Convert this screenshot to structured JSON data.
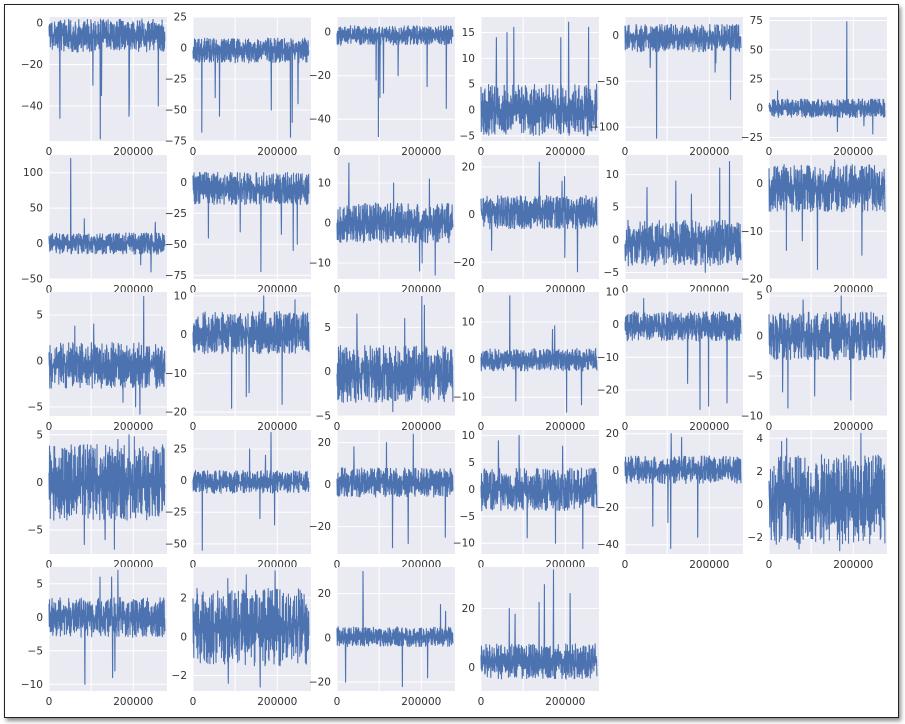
{
  "theme": {
    "panel_bg": "#eaeaf2",
    "grid_color": "#ffffff",
    "line_color": "#4c72b0",
    "tick_color": "#333333"
  },
  "chart_data": [
    {
      "type": "line",
      "xlim": [
        0,
        280000
      ],
      "ylim": [
        -57,
        3
      ],
      "yticks": [
        0,
        -20,
        -40
      ],
      "xticks": [
        0,
        200000
      ],
      "ytick_side": "left",
      "baseline": 2,
      "typical_range": [
        -14,
        2
      ],
      "spikes": [
        -56,
        -46,
        -40,
        -45,
        -35,
        -38,
        -30
      ]
    },
    {
      "type": "line",
      "xlim": [
        0,
        280000
      ],
      "ylim": [
        -75,
        25
      ],
      "yticks": [
        25,
        0,
        -25,
        -50,
        -75
      ],
      "xticks": [
        0,
        200000
      ],
      "ytick_side": "left",
      "baseline": 0,
      "typical_range": [
        -12,
        8
      ],
      "spikes": [
        -72,
        -68,
        -60,
        -55,
        -50,
        -45,
        -40
      ]
    },
    {
      "type": "line",
      "xlim": [
        0,
        280000
      ],
      "ylim": [
        -50,
        7
      ],
      "yticks": [
        0,
        -20,
        -40
      ],
      "xticks": [
        0,
        200000
      ],
      "ytick_side": "left",
      "baseline": 0,
      "typical_range": [
        -6,
        3
      ],
      "spikes": [
        -48,
        -35,
        -30,
        -28,
        -25,
        -22,
        -20
      ]
    },
    {
      "type": "line",
      "xlim": [
        0,
        280000
      ],
      "ylim": [
        -6,
        18
      ],
      "yticks": [
        15,
        10,
        5,
        0,
        -5
      ],
      "xticks": [
        0,
        200000
      ],
      "ytick_side": "left",
      "baseline": 0,
      "typical_range": [
        -5,
        5
      ],
      "spikes": [
        17,
        16,
        16,
        15,
        14,
        14
      ]
    },
    {
      "type": "line",
      "xlim": [
        0,
        280000
      ],
      "ylim": [
        -115,
        20
      ],
      "yticks": [
        0,
        -50,
        -100
      ],
      "xticks": [
        0,
        200000
      ],
      "ytick_side": "left",
      "baseline": 0,
      "typical_range": [
        -18,
        12
      ],
      "spikes": [
        -112,
        -70,
        -40,
        -35,
        -30
      ]
    },
    {
      "type": "line",
      "xlim": [
        0,
        280000
      ],
      "ylim": [
        -28,
        78
      ],
      "yticks": [
        75,
        50,
        25,
        0,
        -25
      ],
      "xticks": [
        0,
        200000
      ],
      "ytick_side": "left",
      "baseline": 0,
      "typical_range": [
        -8,
        8
      ],
      "spikes": [
        74,
        -22,
        -20,
        -18,
        -15,
        15
      ]
    },
    {
      "type": "line",
      "xlim": [
        0,
        280000
      ],
      "ylim": [
        -50,
        125
      ],
      "yticks": [
        100,
        50,
        0,
        -50
      ],
      "xticks": [
        0,
        200000
      ],
      "ytick_side": "left",
      "baseline": 0,
      "typical_range": [
        -15,
        15
      ],
      "spikes": [
        120,
        -40,
        35,
        30,
        -30
      ]
    },
    {
      "type": "line",
      "xlim": [
        0,
        280000
      ],
      "ylim": [
        -78,
        22
      ],
      "yticks": [
        0,
        -25,
        -50,
        -75
      ],
      "xticks": [
        0,
        200000
      ],
      "ytick_side": "left",
      "baseline": 0,
      "typical_range": [
        -18,
        8
      ],
      "spikes": [
        -72,
        -55,
        -50,
        -45,
        -42,
        -40
      ]
    },
    {
      "type": "line",
      "xlim": [
        0,
        280000
      ],
      "ylim": [
        -14,
        17
      ],
      "yticks": [
        10,
        0,
        -10
      ],
      "xticks": [
        0,
        200000
      ],
      "ytick_side": "left",
      "baseline": 0,
      "typical_range": [
        -5,
        5
      ],
      "spikes": [
        15,
        -13,
        -12,
        -10,
        11,
        10
      ]
    },
    {
      "type": "line",
      "xlim": [
        0,
        280000
      ],
      "ylim": [
        -27,
        25
      ],
      "yticks": [
        20,
        0,
        -20
      ],
      "xticks": [
        0,
        200000
      ],
      "ytick_side": "left",
      "baseline": 0,
      "typical_range": [
        -6,
        8
      ],
      "spikes": [
        22,
        -24,
        -18,
        -15,
        16,
        14
      ]
    },
    {
      "type": "line",
      "xlim": [
        0,
        280000
      ],
      "ylim": [
        -6,
        13
      ],
      "yticks": [
        10,
        5,
        0,
        -5
      ],
      "xticks": [
        0,
        200000
      ],
      "ytick_side": "left",
      "baseline": 0,
      "typical_range": [
        -4,
        3
      ],
      "spikes": [
        12,
        11,
        9,
        8,
        -5,
        7
      ]
    },
    {
      "type": "line",
      "xlim": [
        0,
        280000
      ],
      "ylim": [
        -20,
        6
      ],
      "yticks": [
        0,
        -10,
        -20
      ],
      "xticks": [
        0,
        200000
      ],
      "ytick_side": "left",
      "baseline": 0,
      "typical_range": [
        -6,
        4
      ],
      "spikes": [
        -18,
        -15,
        -14,
        -12,
        5
      ]
    },
    {
      "type": "line",
      "xlim": [
        0,
        280000
      ],
      "ylim": [
        -6,
        7.5
      ],
      "yticks": [
        5,
        0,
        -5
      ],
      "xticks": [
        0,
        200000
      ],
      "ytick_side": "left",
      "baseline": 0,
      "typical_range": [
        -3,
        2
      ],
      "spikes": [
        7,
        -5.8,
        -5,
        4,
        -4.5,
        3.8
      ]
    },
    {
      "type": "line",
      "xlim": [
        0,
        280000
      ],
      "ylim": [
        -21,
        11
      ],
      "yticks": [
        10,
        0,
        -10,
        -20
      ],
      "xticks": [
        0,
        200000
      ],
      "ytick_side": "left",
      "baseline": 0,
      "typical_range": [
        -5,
        6
      ],
      "spikes": [
        -19,
        -18,
        -16,
        -15,
        10,
        9
      ]
    },
    {
      "type": "line",
      "xlim": [
        0,
        280000
      ],
      "ylim": [
        -5,
        9
      ],
      "yticks": [
        5,
        0,
        -5
      ],
      "xticks": [
        0,
        200000
      ],
      "ytick_side": "left",
      "baseline": 0,
      "typical_range": [
        -3.5,
        3
      ],
      "spikes": [
        8.5,
        7.5,
        6.5,
        6,
        -4.5
      ]
    },
    {
      "type": "line",
      "xlim": [
        0,
        280000
      ],
      "ylim": [
        -15,
        18
      ],
      "yticks": [
        10,
        0,
        -10
      ],
      "xticks": [
        0,
        200000
      ],
      "ytick_side": "left",
      "baseline": 0,
      "typical_range": [
        -3,
        3
      ],
      "spikes": [
        17,
        -14,
        -12,
        -11,
        8,
        9
      ]
    },
    {
      "type": "line",
      "xlim": [
        0,
        280000
      ],
      "ylim": [
        -28,
        10
      ],
      "yticks": [
        10,
        0,
        -10,
        -20
      ],
      "xticks": [
        0,
        200000
      ],
      "ytick_side": "left",
      "baseline": 0,
      "typical_range": [
        -5,
        4
      ],
      "spikes": [
        -26,
        -25,
        -24,
        -20,
        -18,
        8
      ]
    },
    {
      "type": "line",
      "xlim": [
        0,
        280000
      ],
      "ylim": [
        -10,
        5.5
      ],
      "yticks": [
        5,
        0,
        -5,
        -10
      ],
      "xticks": [
        0,
        200000
      ],
      "ytick_side": "left",
      "baseline": 0,
      "typical_range": [
        -3,
        3
      ],
      "spikes": [
        -9,
        -8,
        -7.5,
        -7,
        5,
        4.5
      ]
    },
    {
      "type": "line",
      "xlim": [
        0,
        280000
      ],
      "ylim": [
        -7.5,
        5.5
      ],
      "yticks": [
        5,
        0,
        -5
      ],
      "xticks": [
        0,
        200000
      ],
      "ytick_side": "left",
      "baseline": 0,
      "typical_range": [
        -4,
        4
      ],
      "spikes": [
        -7,
        5,
        -6.5,
        4.8,
        -6,
        4.5
      ]
    },
    {
      "type": "line",
      "xlim": [
        0,
        280000
      ],
      "ylim": [
        -58,
        40
      ],
      "yticks": [
        25,
        0,
        -25,
        -50
      ],
      "xticks": [
        0,
        200000
      ],
      "ytick_side": "left",
      "baseline": 0,
      "typical_range": [
        -10,
        8
      ],
      "spikes": [
        -55,
        38,
        -35,
        -30,
        25,
        20
      ]
    },
    {
      "type": "line",
      "xlim": [
        0,
        280000
      ],
      "ylim": [
        -33,
        26
      ],
      "yticks": [
        20,
        0,
        -20
      ],
      "xticks": [
        0,
        200000
      ],
      "ytick_side": "left",
      "baseline": 0,
      "typical_range": [
        -6,
        8
      ],
      "spikes": [
        -30,
        24,
        -28,
        -25,
        20,
        18
      ]
    },
    {
      "type": "line",
      "xlim": [
        0,
        280000
      ],
      "ylim": [
        -12,
        11
      ],
      "yticks": [
        10,
        5,
        0,
        -5,
        -10
      ],
      "xticks": [
        0,
        200000
      ],
      "ytick_side": "left",
      "baseline": 0,
      "typical_range": [
        -4,
        4
      ],
      "spikes": [
        -11,
        -10,
        10,
        9,
        -9,
        8
      ]
    },
    {
      "type": "line",
      "xlim": [
        0,
        280000
      ],
      "ylim": [
        -45,
        22
      ],
      "yticks": [
        20,
        0,
        -20,
        -40
      ],
      "xticks": [
        0,
        200000
      ],
      "ytick_side": "left",
      "baseline": 0,
      "typical_range": [
        -7,
        8
      ],
      "spikes": [
        -42,
        -36,
        -30,
        -28,
        20,
        18
      ]
    },
    {
      "type": "line",
      "xlim": [
        0,
        280000
      ],
      "ylim": [
        -3,
        4.5
      ],
      "yticks": [
        4,
        2,
        0,
        -2
      ],
      "xticks": [
        0,
        200000
      ],
      "ytick_side": "left",
      "baseline": 0,
      "typical_range": [
        -2.5,
        3
      ],
      "spikes": [
        4.3,
        -2.8,
        4,
        3.8,
        -2.7
      ]
    },
    {
      "type": "line",
      "xlim": [
        0,
        280000
      ],
      "ylim": [
        -11,
        7.5
      ],
      "yticks": [
        5,
        0,
        -5,
        -10
      ],
      "xticks": [
        0,
        200000
      ],
      "ytick_side": "left",
      "baseline": 0,
      "typical_range": [
        -3,
        3
      ],
      "spikes": [
        -10,
        7,
        -9,
        -8,
        6,
        6
      ]
    },
    {
      "type": "line",
      "xlim": [
        0,
        280000
      ],
      "ylim": [
        -2.8,
        3.6
      ],
      "yticks": [
        2,
        0,
        -2
      ],
      "xticks": [
        0,
        200000
      ],
      "ytick_side": "left",
      "baseline": 0,
      "typical_range": [
        -1.5,
        2.5
      ],
      "spikes": [
        3.4,
        -2.6,
        3.2,
        -2.4,
        3
      ]
    },
    {
      "type": "line",
      "xlim": [
        0,
        280000
      ],
      "ylim": [
        -24,
        32
      ],
      "yticks": [
        20,
        0,
        -20
      ],
      "xticks": [
        0,
        200000
      ],
      "ytick_side": "left",
      "baseline": 0,
      "typical_range": [
        -4,
        5
      ],
      "spikes": [
        30,
        -22,
        -20,
        -18,
        15,
        12
      ]
    },
    {
      "type": "line",
      "xlim": [
        0,
        280000
      ],
      "ylim": [
        -8,
        34
      ],
      "yticks": [
        20,
        0
      ],
      "xticks": [
        0,
        200000
      ],
      "ytick_side": "left",
      "baseline": 0,
      "typical_range": [
        -4,
        8
      ],
      "spikes": [
        33,
        28,
        25,
        22,
        20,
        18
      ]
    }
  ]
}
